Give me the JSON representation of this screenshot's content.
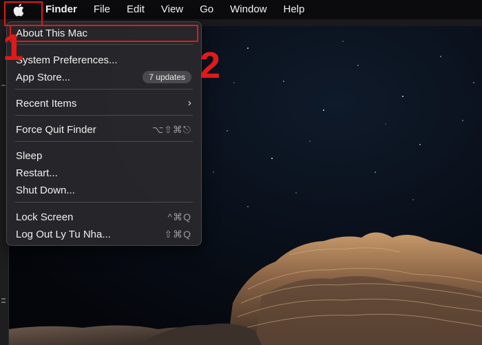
{
  "menubar": {
    "items": [
      "Finder",
      "File",
      "Edit",
      "View",
      "Go",
      "Window",
      "Help"
    ]
  },
  "apple_menu": {
    "about": "About This Mac",
    "system_prefs": "System Preferences...",
    "app_store": "App Store...",
    "app_store_badge": "7 updates",
    "recent_items": "Recent Items",
    "force_quit": "Force Quit Finder",
    "force_quit_shortcut": "⌥⇧⌘⎋",
    "sleep": "Sleep",
    "restart": "Restart...",
    "shut_down": "Shut Down...",
    "lock_screen": "Lock Screen",
    "lock_screen_shortcut": "^⌘Q",
    "log_out": "Log Out Ly Tu Nha...",
    "log_out_shortcut": "⇧⌘Q"
  },
  "annotations": {
    "step1": "1",
    "step2": "2"
  },
  "colors": {
    "annotation_red": "#e01a1a",
    "menu_bg": "#28282c",
    "menubar_bg": "#0b0b0d"
  },
  "icons": {
    "apple": "apple-logo-icon",
    "submenu": "chevron-right-icon"
  }
}
